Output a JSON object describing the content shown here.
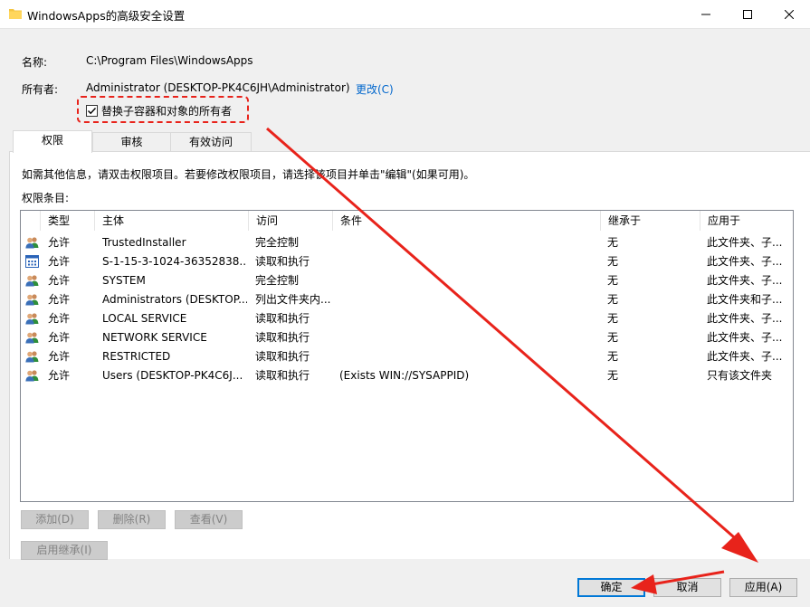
{
  "window": {
    "title": "WindowsApps的高级安全设置",
    "controls": [
      "minimize",
      "maximize",
      "close"
    ]
  },
  "fields": {
    "name_label": "名称:",
    "name_value": "C:\\Program Files\\WindowsApps",
    "owner_label": "所有者:",
    "owner_value": "Administrator (DESKTOP-PK4C6JH\\Administrator)",
    "owner_change_link": "更改(C)",
    "replace_owner_checkbox": "替换子容器和对象的所有者",
    "replace_owner_checked": true
  },
  "tabs": [
    {
      "label": "权限",
      "active": true
    },
    {
      "label": "审核",
      "active": false
    },
    {
      "label": "有效访问",
      "active": false
    }
  ],
  "panel": {
    "info_text": "如需其他信息，请双击权限项目。若要修改权限项目，请选择该项目并单击\"编辑\"(如果可用)。",
    "entries_label": "权限条目:"
  },
  "permissions": {
    "columns": [
      "类型",
      "主体",
      "访问",
      "条件",
      "继承于",
      "应用于"
    ],
    "rows": [
      {
        "icon": "user-group-icon",
        "type": "允许",
        "principal": "TrustedInstaller",
        "access": "完全控制",
        "condition": "",
        "inherited": "无",
        "applies": "此文件夹、子..."
      },
      {
        "icon": "package-sid-icon",
        "type": "允许",
        "principal": "S-1-15-3-1024-36352838...",
        "access": "读取和执行",
        "condition": "",
        "inherited": "无",
        "applies": "此文件夹、子..."
      },
      {
        "icon": "user-group-icon",
        "type": "允许",
        "principal": "SYSTEM",
        "access": "完全控制",
        "condition": "",
        "inherited": "无",
        "applies": "此文件夹、子..."
      },
      {
        "icon": "user-group-icon",
        "type": "允许",
        "principal": "Administrators (DESKTOP...",
        "access": "列出文件夹内...",
        "condition": "",
        "inherited": "无",
        "applies": "此文件夹和子..."
      },
      {
        "icon": "user-group-icon",
        "type": "允许",
        "principal": "LOCAL SERVICE",
        "access": "读取和执行",
        "condition": "",
        "inherited": "无",
        "applies": "此文件夹、子..."
      },
      {
        "icon": "user-group-icon",
        "type": "允许",
        "principal": "NETWORK SERVICE",
        "access": "读取和执行",
        "condition": "",
        "inherited": "无",
        "applies": "此文件夹、子..."
      },
      {
        "icon": "user-group-icon",
        "type": "允许",
        "principal": "RESTRICTED",
        "access": "读取和执行",
        "condition": "",
        "inherited": "无",
        "applies": "此文件夹、子..."
      },
      {
        "icon": "user-group-icon",
        "type": "允许",
        "principal": "Users (DESKTOP-PK4C6J...",
        "access": "读取和执行",
        "condition": "(Exists WIN://SYSAPPID)",
        "inherited": "无",
        "applies": "只有该文件夹"
      }
    ]
  },
  "buttons": {
    "add": "添加(D)",
    "remove": "删除(R)",
    "view": "查看(V)",
    "enable_inheritance": "启用继承(I)",
    "ok": "确定",
    "cancel": "取消",
    "apply": "应用(A)"
  },
  "colors": {
    "annotation_red": "#e8231b",
    "link_blue": "#0066cc",
    "focus_blue": "#0078d7"
  }
}
